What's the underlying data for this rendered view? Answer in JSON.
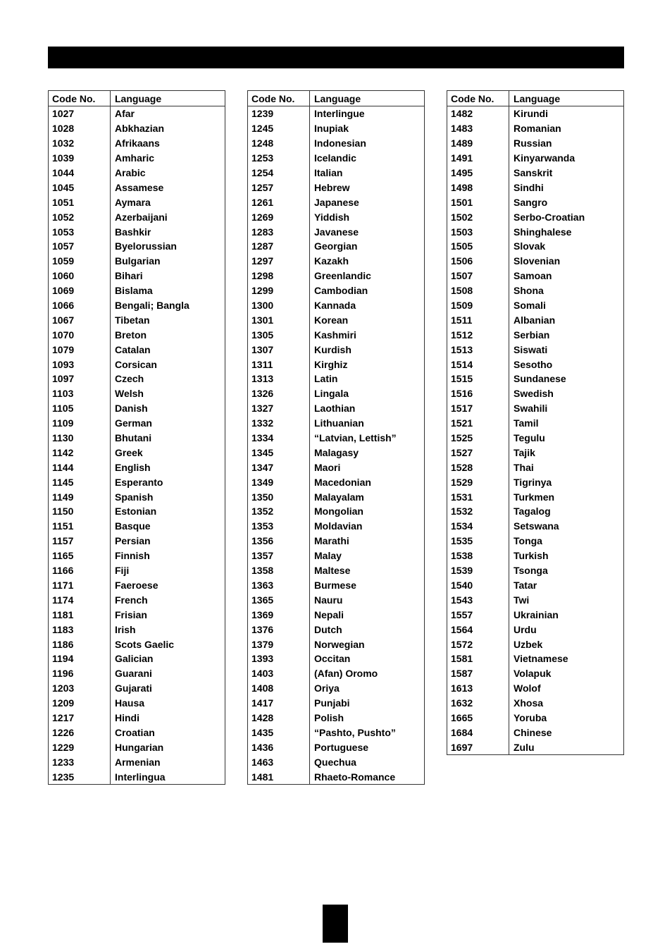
{
  "header": {
    "title": ""
  },
  "columns": {
    "code": "Code No.",
    "language": "Language"
  },
  "tables": [
    {
      "rows": [
        [
          "1027",
          "Afar"
        ],
        [
          "1028",
          "Abkhazian"
        ],
        [
          "1032",
          "Afrikaans"
        ],
        [
          "1039",
          "Amharic"
        ],
        [
          "1044",
          "Arabic"
        ],
        [
          "1045",
          "Assamese"
        ],
        [
          "1051",
          "Aymara"
        ],
        [
          "1052",
          "Azerbaijani"
        ],
        [
          "1053",
          "Bashkir"
        ],
        [
          "1057",
          "Byelorussian"
        ],
        [
          "1059",
          "Bulgarian"
        ],
        [
          "1060",
          "Bihari"
        ],
        [
          "1069",
          "Bislama"
        ],
        [
          "1066",
          "Bengali; Bangla"
        ],
        [
          "1067",
          "Tibetan"
        ],
        [
          "1070",
          "Breton"
        ],
        [
          "1079",
          "Catalan"
        ],
        [
          "1093",
          "Corsican"
        ],
        [
          "1097",
          "Czech"
        ],
        [
          "1103",
          "Welsh"
        ],
        [
          "1105",
          "Danish"
        ],
        [
          "1109",
          "German"
        ],
        [
          "1130",
          "Bhutani"
        ],
        [
          "1142",
          "Greek"
        ],
        [
          "1144",
          "English"
        ],
        [
          "1145",
          "Esperanto"
        ],
        [
          "1149",
          "Spanish"
        ],
        [
          "1150",
          "Estonian"
        ],
        [
          "1151",
          "Basque"
        ],
        [
          "1157",
          "Persian"
        ],
        [
          "1165",
          "Finnish"
        ],
        [
          "1166",
          "Fiji"
        ],
        [
          "1171",
          "Faeroese"
        ],
        [
          "1174",
          "French"
        ],
        [
          "1181",
          "Frisian"
        ],
        [
          "1183",
          "Irish"
        ],
        [
          "1186",
          "Scots Gaelic"
        ],
        [
          "1194",
          "Galician"
        ],
        [
          "1196",
          "Guarani"
        ],
        [
          "1203",
          "Gujarati"
        ],
        [
          "1209",
          "Hausa"
        ],
        [
          "1217",
          "Hindi"
        ],
        [
          "1226",
          "Croatian"
        ],
        [
          "1229",
          "Hungarian"
        ],
        [
          "1233",
          "Armenian"
        ],
        [
          "1235",
          "Interlingua"
        ]
      ]
    },
    {
      "rows": [
        [
          "1239",
          "Interlingue"
        ],
        [
          "1245",
          "Inupiak"
        ],
        [
          "1248",
          "Indonesian"
        ],
        [
          "1253",
          "Icelandic"
        ],
        [
          "1254",
          "Italian"
        ],
        [
          "1257",
          "Hebrew"
        ],
        [
          "1261",
          "Japanese"
        ],
        [
          "1269",
          "Yiddish"
        ],
        [
          "1283",
          "Javanese"
        ],
        [
          "1287",
          "Georgian"
        ],
        [
          "1297",
          "Kazakh"
        ],
        [
          "1298",
          "Greenlandic"
        ],
        [
          "1299",
          "Cambodian"
        ],
        [
          "1300",
          "Kannada"
        ],
        [
          "1301",
          "Korean"
        ],
        [
          "1305",
          "Kashmiri"
        ],
        [
          "1307",
          "Kurdish"
        ],
        [
          "1311",
          "Kirghiz"
        ],
        [
          "1313",
          "Latin"
        ],
        [
          "1326",
          "Lingala"
        ],
        [
          "1327",
          "Laothian"
        ],
        [
          "1332",
          "Lithuanian"
        ],
        [
          "1334",
          "“Latvian, Lettish”"
        ],
        [
          "1345",
          "Malagasy"
        ],
        [
          "1347",
          "Maori"
        ],
        [
          "1349",
          "Macedonian"
        ],
        [
          "1350",
          "Malayalam"
        ],
        [
          "1352",
          "Mongolian"
        ],
        [
          "1353",
          "Moldavian"
        ],
        [
          "1356",
          "Marathi"
        ],
        [
          "1357",
          "Malay"
        ],
        [
          "1358",
          "Maltese"
        ],
        [
          "1363",
          "Burmese"
        ],
        [
          "1365",
          "Nauru"
        ],
        [
          "1369",
          "Nepali"
        ],
        [
          "1376",
          "Dutch"
        ],
        [
          "1379",
          "Norwegian"
        ],
        [
          "1393",
          "Occitan"
        ],
        [
          "1403",
          "(Afan) Oromo"
        ],
        [
          "1408",
          "Oriya"
        ],
        [
          "1417",
          "Punjabi"
        ],
        [
          "1428",
          "Polish"
        ],
        [
          "1435",
          "“Pashto, Pushto”"
        ],
        [
          "1436",
          "Portuguese"
        ],
        [
          "1463",
          "Quechua"
        ],
        [
          "1481",
          "Rhaeto-Romance"
        ]
      ]
    },
    {
      "rows": [
        [
          "1482",
          "Kirundi"
        ],
        [
          "1483",
          "Romanian"
        ],
        [
          "1489",
          "Russian"
        ],
        [
          "1491",
          "Kinyarwanda"
        ],
        [
          "1495",
          "Sanskrit"
        ],
        [
          "1498",
          "Sindhi"
        ],
        [
          "1501",
          "Sangro"
        ],
        [
          "1502",
          "Serbo-Croatian"
        ],
        [
          "1503",
          "Shinghalese"
        ],
        [
          "1505",
          "Slovak"
        ],
        [
          "1506",
          "Slovenian"
        ],
        [
          "1507",
          "Samoan"
        ],
        [
          "1508",
          "Shona"
        ],
        [
          "1509",
          "Somali"
        ],
        [
          "1511",
          "Albanian"
        ],
        [
          "1512",
          "Serbian"
        ],
        [
          "1513",
          "Siswati"
        ],
        [
          "1514",
          "Sesotho"
        ],
        [
          "1515",
          "Sundanese"
        ],
        [
          "1516",
          "Swedish"
        ],
        [
          "1517",
          "Swahili"
        ],
        [
          "1521",
          "Tamil"
        ],
        [
          "1525",
          "Tegulu"
        ],
        [
          "1527",
          "Tajik"
        ],
        [
          "1528",
          "Thai"
        ],
        [
          "1529",
          "Tigrinya"
        ],
        [
          "1531",
          "Turkmen"
        ],
        [
          "1532",
          "Tagalog"
        ],
        [
          "1534",
          "Setswana"
        ],
        [
          "1535",
          "Tonga"
        ],
        [
          "1538",
          "Turkish"
        ],
        [
          "1539",
          "Tsonga"
        ],
        [
          "1540",
          "Tatar"
        ],
        [
          "1543",
          "Twi"
        ],
        [
          "1557",
          "Ukrainian"
        ],
        [
          "1564",
          "Urdu"
        ],
        [
          "1572",
          "Uzbek"
        ],
        [
          "1581",
          "Vietnamese"
        ],
        [
          "1587",
          "Volapuk"
        ],
        [
          "1613",
          "Wolof"
        ],
        [
          "1632",
          "Xhosa"
        ],
        [
          "1665",
          "Yoruba"
        ],
        [
          "1684",
          "Chinese"
        ],
        [
          "1697",
          "Zulu"
        ]
      ]
    }
  ],
  "footer": {
    "page_number": ""
  },
  "colors": {
    "bar": "#000000",
    "border": "#333333",
    "text": "#000000",
    "background": "#ffffff"
  }
}
